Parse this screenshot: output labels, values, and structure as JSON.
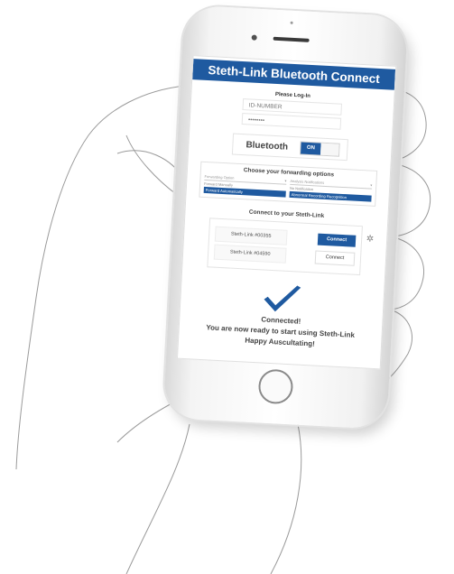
{
  "app": {
    "title": "Steth-Link Bluetooth Connect"
  },
  "login": {
    "heading": "Please Log-In",
    "id_placeholder": "ID-NUMBER",
    "password_value": "••••••••"
  },
  "bluetooth": {
    "label": "Bluetooth",
    "toggle_on_label": "ON"
  },
  "forwarding": {
    "title": "Choose your forwarding options",
    "left_header": "Forwarding Option",
    "left_options": [
      "Forward Manually",
      "Forward Automatically"
    ],
    "left_selected_index": 1,
    "right_header": "Analysis Notifications",
    "right_options": [
      "No Notification",
      "Abnormal Recording Recognition"
    ],
    "right_selected_index": 1
  },
  "connect": {
    "title": "Connect to your Steth-Link",
    "devices": [
      {
        "name": "Steth-Link #00355",
        "button": "Connect",
        "active": true
      },
      {
        "name": "Steth-Link #04590",
        "button": "Connect",
        "active": false
      }
    ]
  },
  "status": {
    "line1": "Connected!",
    "line2": "You are now ready to start using Steth-Link",
    "line3": "Happy Auscultating!"
  },
  "colors": {
    "brand": "#1f5aa0",
    "check": "#1f5aa0"
  }
}
